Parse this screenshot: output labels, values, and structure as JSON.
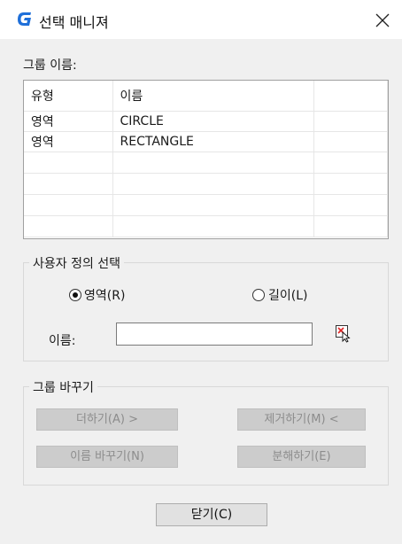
{
  "window": {
    "title": "선택 매니져",
    "app_icon": "gstarcad-logo-icon",
    "close_icon": "close-x-icon"
  },
  "group_name": {
    "label": "그룹 이름:"
  },
  "table": {
    "columns": [
      "유형",
      "이름",
      ""
    ],
    "rows": [
      [
        "영역",
        "CIRCLE"
      ],
      [
        "영역",
        "RECTANGLE"
      ]
    ]
  },
  "custom_selection": {
    "legend": "사용자 정의 선택",
    "radio_area": {
      "label": "영역(R)",
      "checked": true
    },
    "radio_length": {
      "label": "길이(L)",
      "checked": false
    },
    "name_label": "이름:",
    "name_value": "",
    "select_icon": "select-objects-icon"
  },
  "change_group": {
    "legend": "그룹 바꾸기",
    "add_label": "더하기(A) >",
    "remove_label": "제거하기(M) <",
    "rename_label": "이름 바꾸기(N)",
    "explode_label": "분해하기(E)"
  },
  "footer": {
    "close_label": "닫기(C)"
  },
  "colors": {
    "accent_blue": "#1e6fd9",
    "dialog_bg": "#f0f0f0",
    "disabled_button": "#cccccc"
  }
}
